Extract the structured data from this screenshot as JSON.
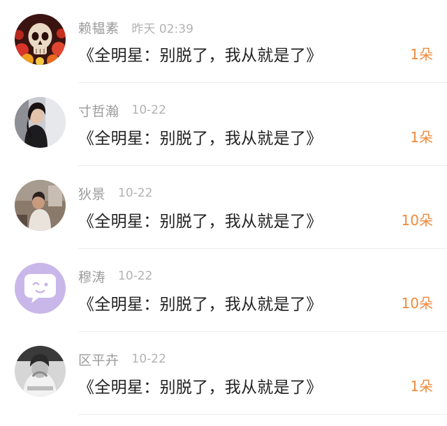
{
  "accent_color": "#f08a3c",
  "comments": [
    {
      "user": "赖韫素",
      "time": "昨天 02:39",
      "message": "《全明星：别脱了，我从就是了》",
      "gift_count": "1朵",
      "avatar_icon": "skull-flowers-avatar-icon"
    },
    {
      "user": "寸哲瀚",
      "time": "10-22",
      "message": "《全明星：别脱了，我从就是了》",
      "gift_count": "1朵",
      "avatar_icon": "woman-photo-avatar-icon"
    },
    {
      "user": "狄景",
      "time": "10-22",
      "message": "《全明星：别脱了，我从就是了》",
      "gift_count": "10朵",
      "avatar_icon": "person-photo-avatar-icon"
    },
    {
      "user": "穆涛",
      "time": "10-22",
      "message": "《全明星：别脱了，我从就是了》",
      "gift_count": "10朵",
      "avatar_icon": "chat-bubble-avatar-icon"
    },
    {
      "user": "区平卉",
      "time": "10-22",
      "message": "《全明星：别脱了，我从就是了》",
      "gift_count": "1朵",
      "avatar_icon": "monochrome-photo-avatar-icon"
    }
  ]
}
